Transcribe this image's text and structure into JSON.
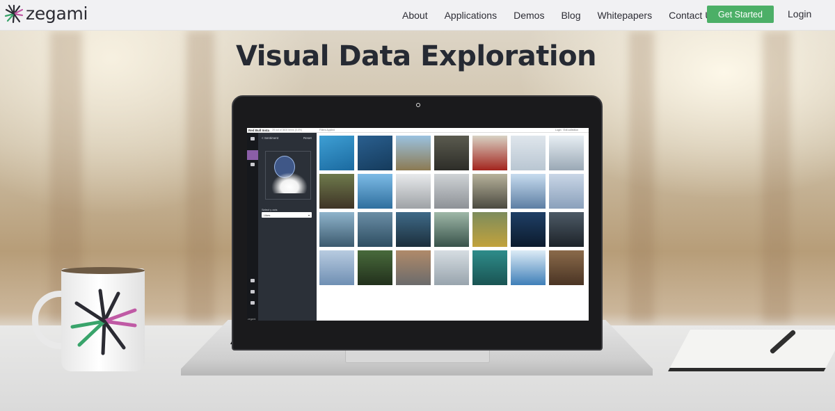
{
  "brand": {
    "name": "zegami"
  },
  "nav": {
    "items": [
      "About",
      "Applications",
      "Demos",
      "Blog",
      "Whitepapers",
      "Contact Us"
    ],
    "cta": "Get Started",
    "login": "Login"
  },
  "hero": {
    "title": "Visual Data Exploration"
  },
  "screen": {
    "app_title": "Red Bull Insta",
    "item_count": "28 out of 3600 items (0.4%)",
    "filters": "Filters Applied",
    "login_link": "Login · Exit collection",
    "panel_heading": "< Sentiment",
    "reset_label": "Reset",
    "axis_label": "Select y axis",
    "axis_value": "Likes",
    "wordmark": "zegami"
  },
  "colors": {
    "accent_green": "#4caf67",
    "nav_background": "#f1f1f3",
    "panel_purple": "#8b5ea7"
  },
  "icons": [
    "sparkle-logo-icon",
    "search-icon",
    "filter-icon",
    "chart-icon",
    "settings-icon",
    "chevron-down-icon"
  ]
}
